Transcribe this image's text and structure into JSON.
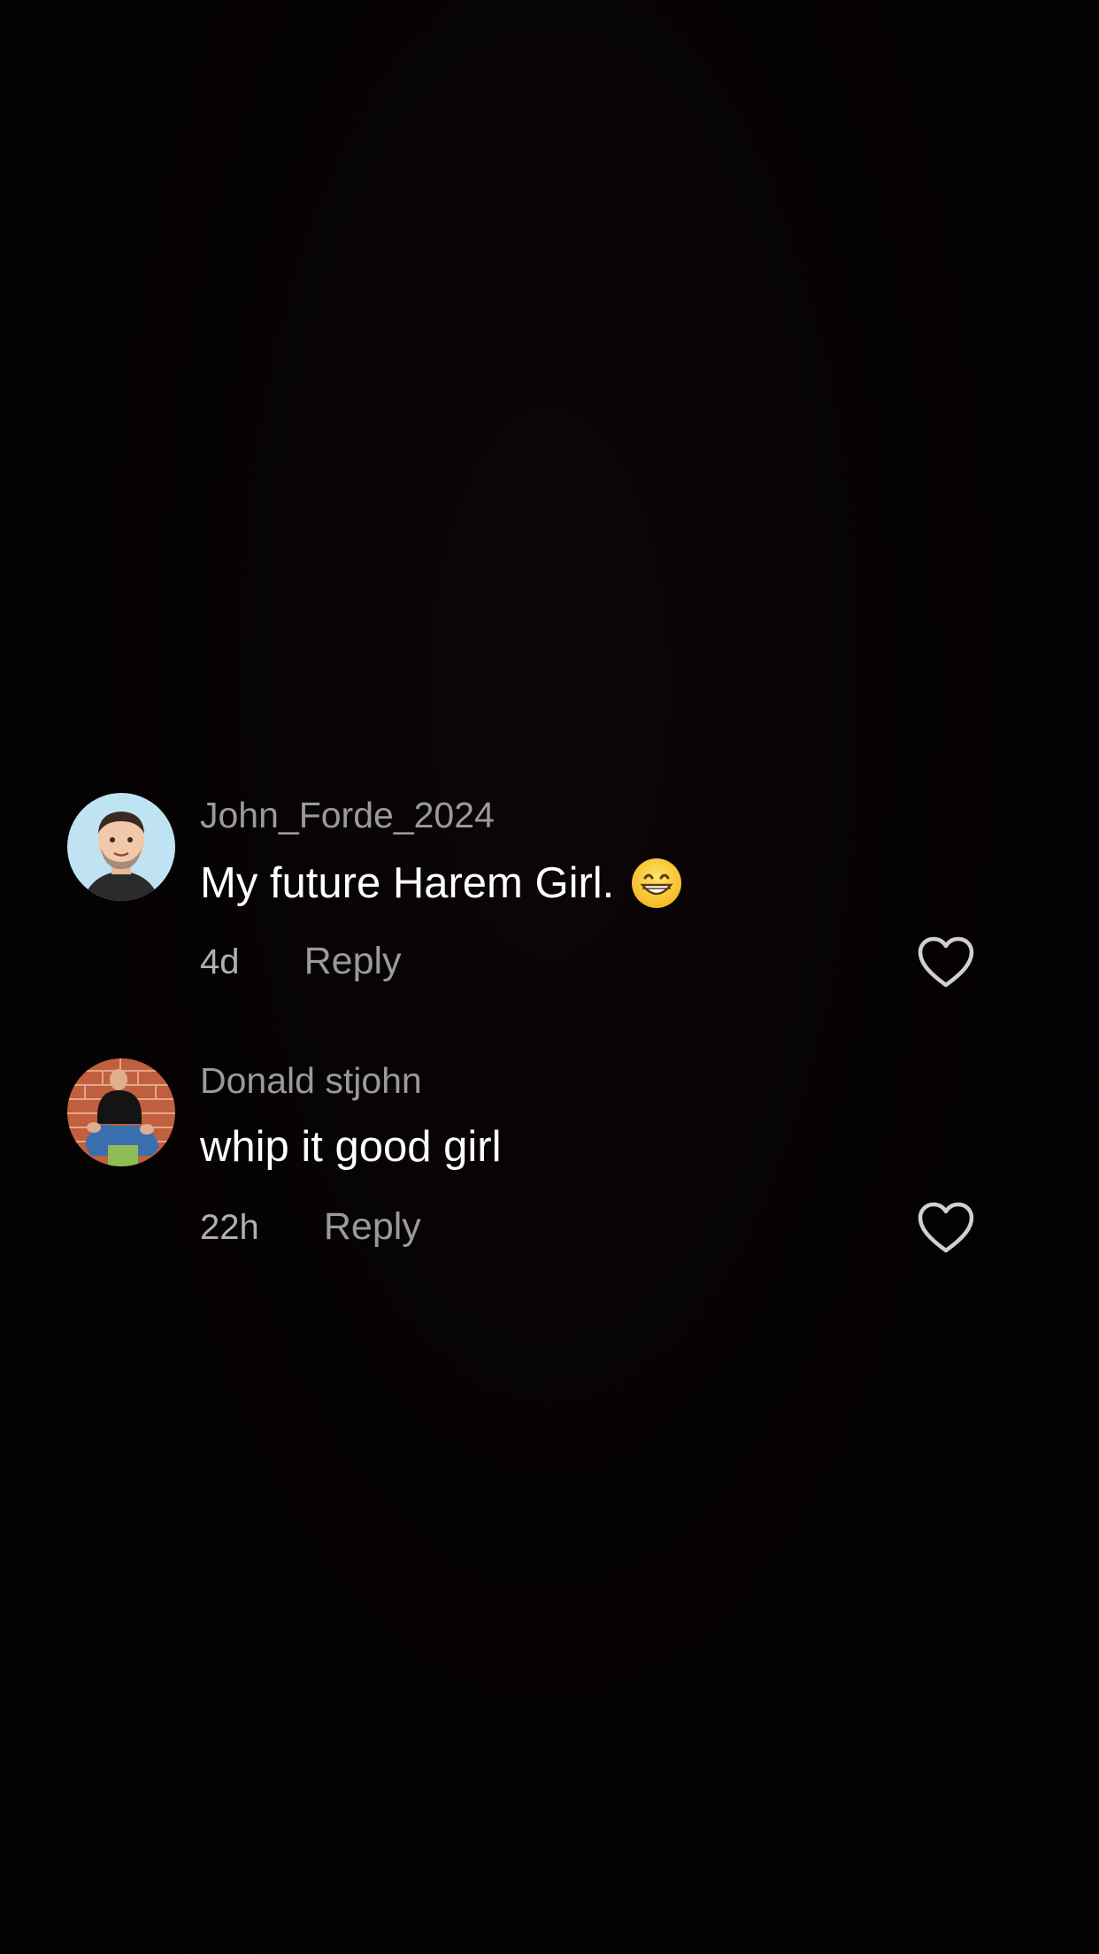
{
  "comments": [
    {
      "username": "John_Forde_2024",
      "text": "My future Harem Girl.",
      "emoji": "grinning-face-emoji",
      "time": "4d",
      "reply_label": "Reply",
      "avatar": "memoji-avatar"
    },
    {
      "username": "Donald stjohn",
      "text": "whip it good girl",
      "time": "22h",
      "reply_label": "Reply",
      "avatar": "photo-avatar"
    }
  ],
  "colors": {
    "background": "#050204",
    "username": "#9a9a9a",
    "text": "#ffffff",
    "meta": "#b0b0b0",
    "like_icon": "#d0d0d0"
  }
}
